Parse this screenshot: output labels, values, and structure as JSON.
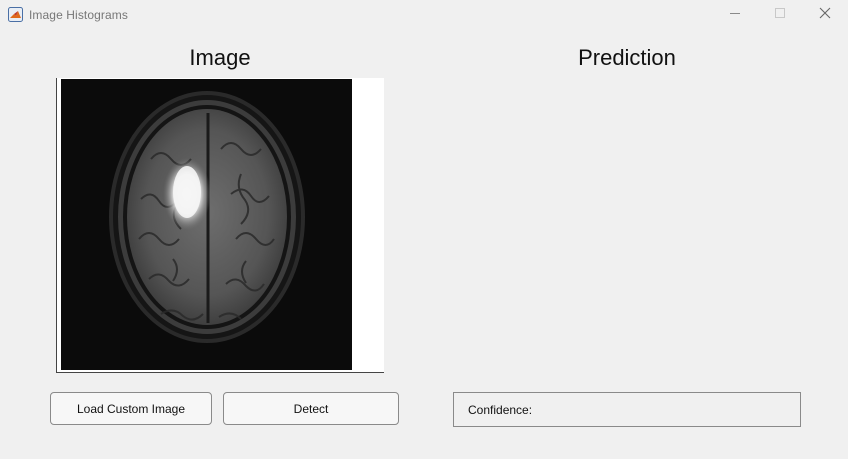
{
  "window": {
    "title": "Image Histograms",
    "icon": "matlab-icon",
    "controls": [
      "minimize-icon",
      "maximize-icon",
      "close-icon"
    ]
  },
  "left_panel": {
    "heading": "Image",
    "image_content": "axial brain MRI scan"
  },
  "right_panel": {
    "heading": "Prediction",
    "confidence_label": "Confidence:"
  },
  "buttons": {
    "load": "Load Custom Image",
    "detect": "Detect"
  },
  "colors": {
    "background": "#f0f0f0",
    "button_border": "#8a8a8a"
  }
}
